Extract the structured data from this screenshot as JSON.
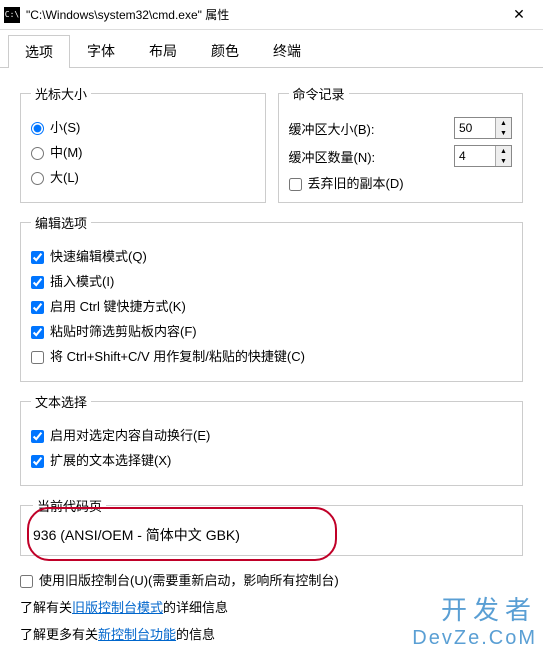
{
  "titlebar": {
    "icon_text": "C:\\",
    "title": "\"C:\\Windows\\system32\\cmd.exe\" 属性"
  },
  "tabs": {
    "items": [
      "选项",
      "字体",
      "布局",
      "颜色",
      "终端"
    ],
    "active_index": 0
  },
  "cursor_size": {
    "legend": "光标大小",
    "small": "小(S)",
    "medium": "中(M)",
    "large": "大(L)",
    "selected": "small"
  },
  "cmd_history": {
    "legend": "命令记录",
    "buffer_size_label": "缓冲区大小(B):",
    "buffer_size_value": "50",
    "buffer_count_label": "缓冲区数量(N):",
    "buffer_count_value": "4",
    "discard_dup_label": "丢弃旧的副本(D)",
    "discard_dup_checked": false
  },
  "edit_options": {
    "legend": "编辑选项",
    "quick_edit": "快速编辑模式(Q)",
    "insert_mode": "插入模式(I)",
    "ctrl_shortcut": "启用 Ctrl 键快捷方式(K)",
    "paste_filter": "粘贴时筛选剪贴板内容(F)",
    "ctrl_shift_cv": "将 Ctrl+Shift+C/V 用作复制/粘贴的快捷键(C)",
    "checked": {
      "quick_edit": true,
      "insert_mode": true,
      "ctrl_shortcut": true,
      "paste_filter": true,
      "ctrl_shift_cv": false
    }
  },
  "text_select": {
    "legend": "文本选择",
    "auto_wrap": "启用对选定内容自动换行(E)",
    "ext_keys": "扩展的文本选择键(X)",
    "checked": {
      "auto_wrap": true,
      "ext_keys": true
    }
  },
  "codepage": {
    "legend": "当前代码页",
    "value": "936   (ANSI/OEM - 简体中文 GBK)"
  },
  "legacy": {
    "checkbox_label": "使用旧版控制台(U)(需要重新启动，影响所有控制台)",
    "checked": false,
    "info1_prefix": "了解有关",
    "info1_link": "旧版控制台模式",
    "info1_suffix": "的详细信息",
    "info2_prefix": "了解更多有关",
    "info2_link": "新控制台功能",
    "info2_suffix": "的信息"
  },
  "watermark": {
    "line1": "开发者",
    "line2": "DevZe.CoM"
  }
}
